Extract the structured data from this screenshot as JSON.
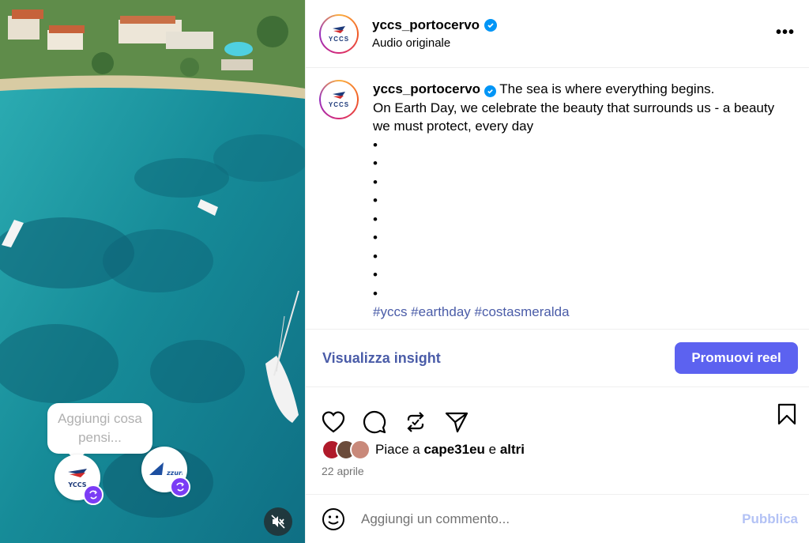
{
  "media": {
    "comment_bubble": "Aggiungi cosa pensi...",
    "collaborators": [
      "YCCS",
      "Azzurra"
    ],
    "mute_icon": "muted-speaker-icon"
  },
  "header": {
    "username": "yccs_portocervo",
    "subtitle": "Audio originale",
    "more_icon": "more-options-icon",
    "avatar_text": "YCCS"
  },
  "caption": {
    "username": "yccs_portocervo",
    "line1": " The sea is where everything begins.",
    "line2": "On Earth Day, we celebrate the beauty that surrounds us - a beauty we must protect, every day",
    "bullet": "•",
    "hashtags": "#yccs #earthday #costasmeralda"
  },
  "insights": {
    "label": "Visualizza insight",
    "promote": "Promuovi reel"
  },
  "actions": [
    "heart-icon",
    "comment-icon",
    "repost-icon",
    "share-icon",
    "bookmark-icon"
  ],
  "likes": {
    "prefix": "Piace a ",
    "user": "cape31eu",
    "middle": " e ",
    "others": "altri",
    "date": "22 aprile"
  },
  "comment": {
    "placeholder": "Aggiungi un commento...",
    "publish": "Pubblica"
  },
  "colors": {
    "accent": "#5c62f0",
    "link": "#4a5ca8",
    "verified": "#0095f6",
    "sea": "#1a8c9a"
  }
}
